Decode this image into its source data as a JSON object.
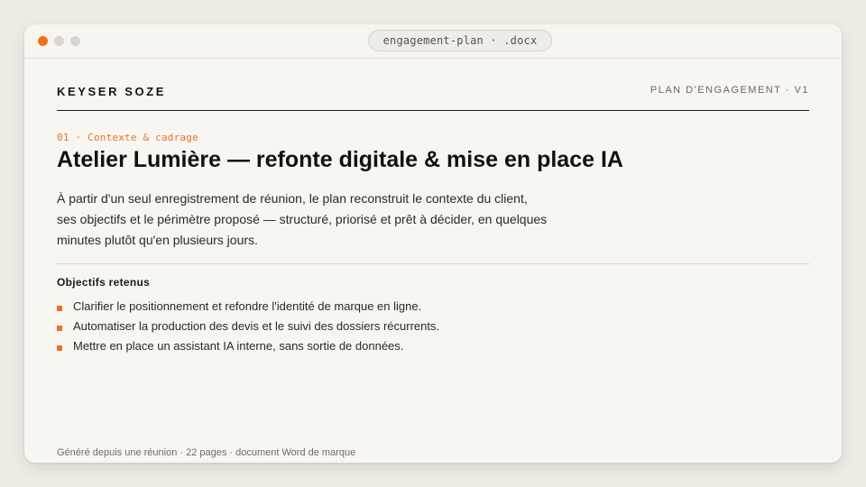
{
  "window": {
    "tab_title": "engagement-plan · .docx",
    "traffic_lights": {
      "close_color": "#f2711c",
      "minimize_color": "#d9d6d1",
      "maximize_color": "#d9d6d1"
    }
  },
  "document": {
    "brand": "KEYSER SOZE",
    "doc_label": "PLAN D'ENGAGEMENT · V1",
    "section_kicker": "01 · Contexte & cadrage",
    "title": "Atelier Lumière — refonte digitale & mise en place IA",
    "intro": "À partir d'un seul enregistrement de réunion, le plan reconstruit le contexte du client, ses objectifs et le périmètre proposé — structuré, priorisé et prêt à décider, en quelques minutes plutôt qu'en plusieurs jours.",
    "objectives_heading": "Objectifs retenus",
    "objectives": [
      "Clarifier le positionnement et refondre l'identité de marque en ligne.",
      "Automatiser la production des devis et le suivi des dossiers récurrents.",
      "Mettre en place un assistant IA interne, sans sortie de données."
    ],
    "footer_note": "Généré depuis une réunion · 22 pages · document Word de marque",
    "accent_color": "#e8732a"
  }
}
